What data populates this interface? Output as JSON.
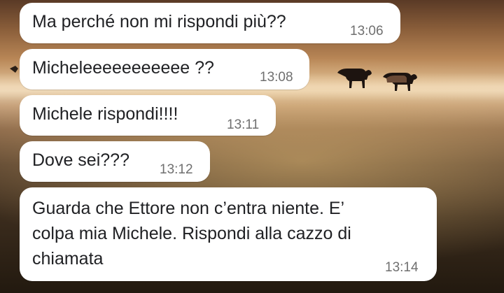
{
  "chat": {
    "messages": [
      {
        "text": "Ma perché non mi rispondi più??",
        "time": "13:06"
      },
      {
        "text": "Micheleeeeeeeeeee ??",
        "time": "13:08"
      },
      {
        "text": "Michele rispondi!!!!",
        "time": "13:11"
      },
      {
        "text": "Dove sei???",
        "time": "13:12"
      },
      {
        "text": "Guarda che Ettore non c’entra niente. E’\ncolpa mia Michele. Rispondi alla cazzo di\nchiamata",
        "time": "13:14"
      }
    ]
  },
  "colors": {
    "bubble": "#ffffff",
    "message_text": "#202124",
    "timestamp": "#6f6f6f"
  }
}
